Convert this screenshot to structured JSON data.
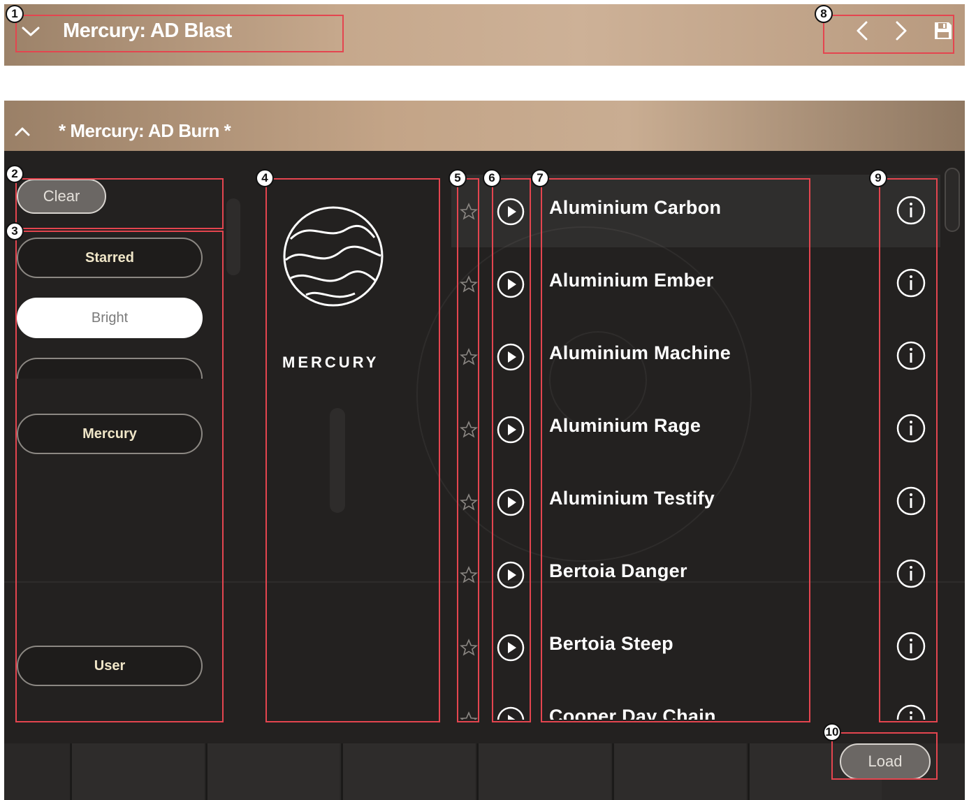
{
  "top_bar": {
    "title": "Mercury: AD Blast"
  },
  "browser": {
    "title": "* Mercury: AD Burn *",
    "clear_label": "Clear",
    "filters": [
      {
        "label": "Starred",
        "state": "default"
      },
      {
        "label": "Bright",
        "state": "selected"
      },
      {
        "label": "",
        "state": "partially-visible"
      },
      {
        "label": "Mercury",
        "state": "default"
      },
      {
        "label": "User",
        "state": "default"
      }
    ],
    "brand": {
      "name": "MERCURY"
    },
    "presets": [
      {
        "name": "Aluminium Carbon"
      },
      {
        "name": "Aluminium Ember"
      },
      {
        "name": "Aluminium Machine"
      },
      {
        "name": "Aluminium Rage"
      },
      {
        "name": "Aluminium Testify"
      },
      {
        "name": "Bertoia Danger"
      },
      {
        "name": "Bertoia Steep"
      },
      {
        "name": "Cooper Day Chain"
      }
    ],
    "load_label": "Load"
  },
  "annotations": [
    "1",
    "2",
    "3",
    "4",
    "5",
    "6",
    "7",
    "8",
    "9",
    "10"
  ],
  "colors": {
    "accent": "#e4454f",
    "header_gradient": "#c6a88c",
    "panel_bg": "#232120"
  }
}
